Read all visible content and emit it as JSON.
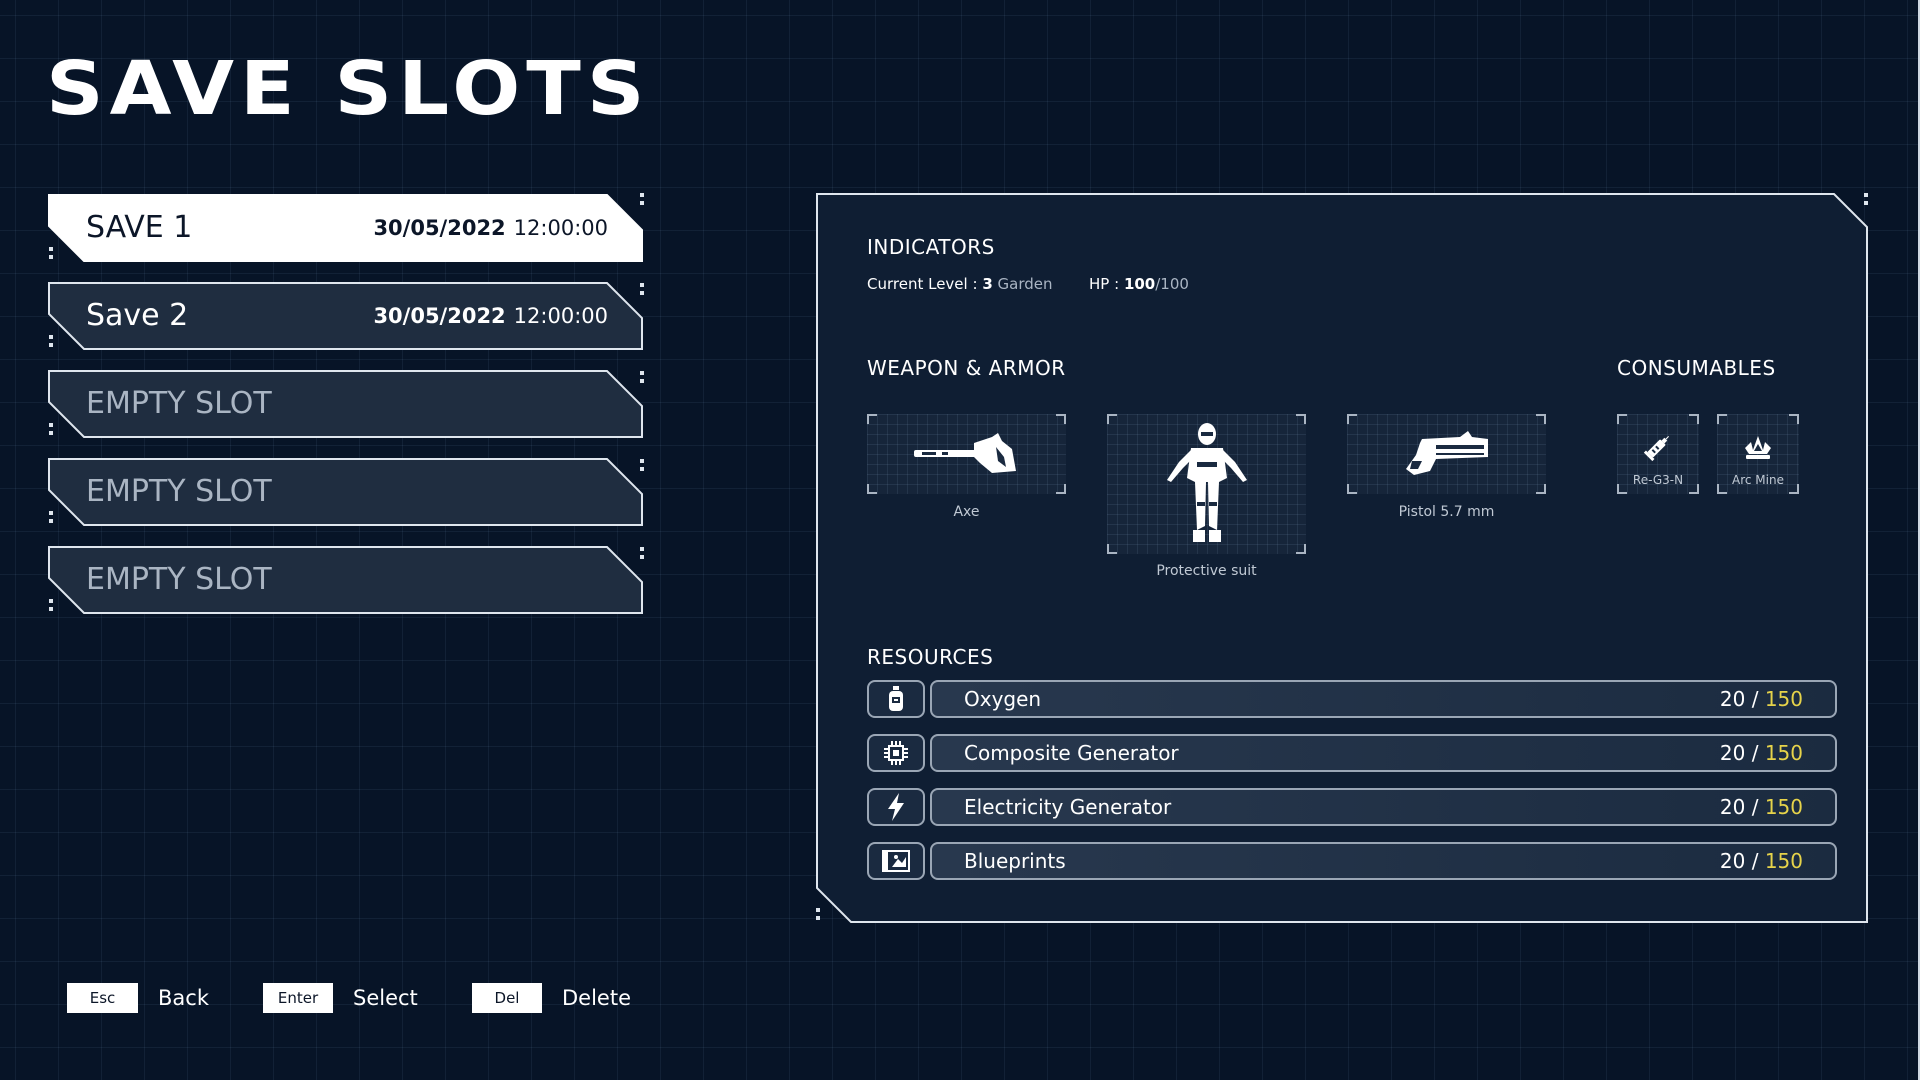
{
  "screen": {
    "title": "SAVE SLOTS"
  },
  "slots": [
    {
      "label": "SAVE 1",
      "date": "30/05/2022",
      "time": "12:00:00",
      "selected": true
    },
    {
      "label": "Save 2",
      "date": "30/05/2022",
      "time": "12:00:00",
      "selected": false
    },
    {
      "label": "EMPTY SLOT"
    },
    {
      "label": "EMPTY SLOT"
    },
    {
      "label": "EMPTY SLOT"
    }
  ],
  "indicators": {
    "title": "INDICATORS",
    "level_label": "Current Level :",
    "level_value": "3",
    "level_name": "Garden",
    "hp_label": "HP :",
    "hp_current": "100",
    "hp_max": "/100"
  },
  "equipment": {
    "weapons_title": "WEAPON & ARMOR",
    "consumables_title": "CONSUMABLES",
    "items": [
      {
        "name": "Axe",
        "icon": "axe-icon"
      },
      {
        "name": "Protective suit",
        "icon": "protective-suit-icon"
      },
      {
        "name": "Pistol 5.7 mm",
        "icon": "pistol-icon"
      }
    ],
    "consumables": [
      {
        "name": "Re-G3-N",
        "icon": "syringe-icon"
      },
      {
        "name": "Arc Mine",
        "icon": "arc-mine-icon"
      }
    ]
  },
  "resources": {
    "title": "RESOURCES",
    "items": [
      {
        "name": "Oxygen",
        "current": "20",
        "max": "150",
        "icon": "oxygen-tank-icon"
      },
      {
        "name": "Composite Generator",
        "current": "20",
        "max": "150",
        "icon": "chip-icon"
      },
      {
        "name": "Electricity Generator",
        "current": "20",
        "max": "150",
        "icon": "lightning-icon"
      },
      {
        "name": "Blueprints",
        "current": "20",
        "max": "150",
        "icon": "blueprint-icon"
      }
    ],
    "separator": " / "
  },
  "footer": {
    "keys": [
      {
        "key": "Esc",
        "action": "Back"
      },
      {
        "key": "Enter",
        "action": "Select"
      },
      {
        "key": "Del",
        "action": "Delete"
      }
    ]
  },
  "colors": {
    "accent_yellow": "#e6d34a",
    "background": "#071427",
    "panel": "#0f1e33"
  }
}
